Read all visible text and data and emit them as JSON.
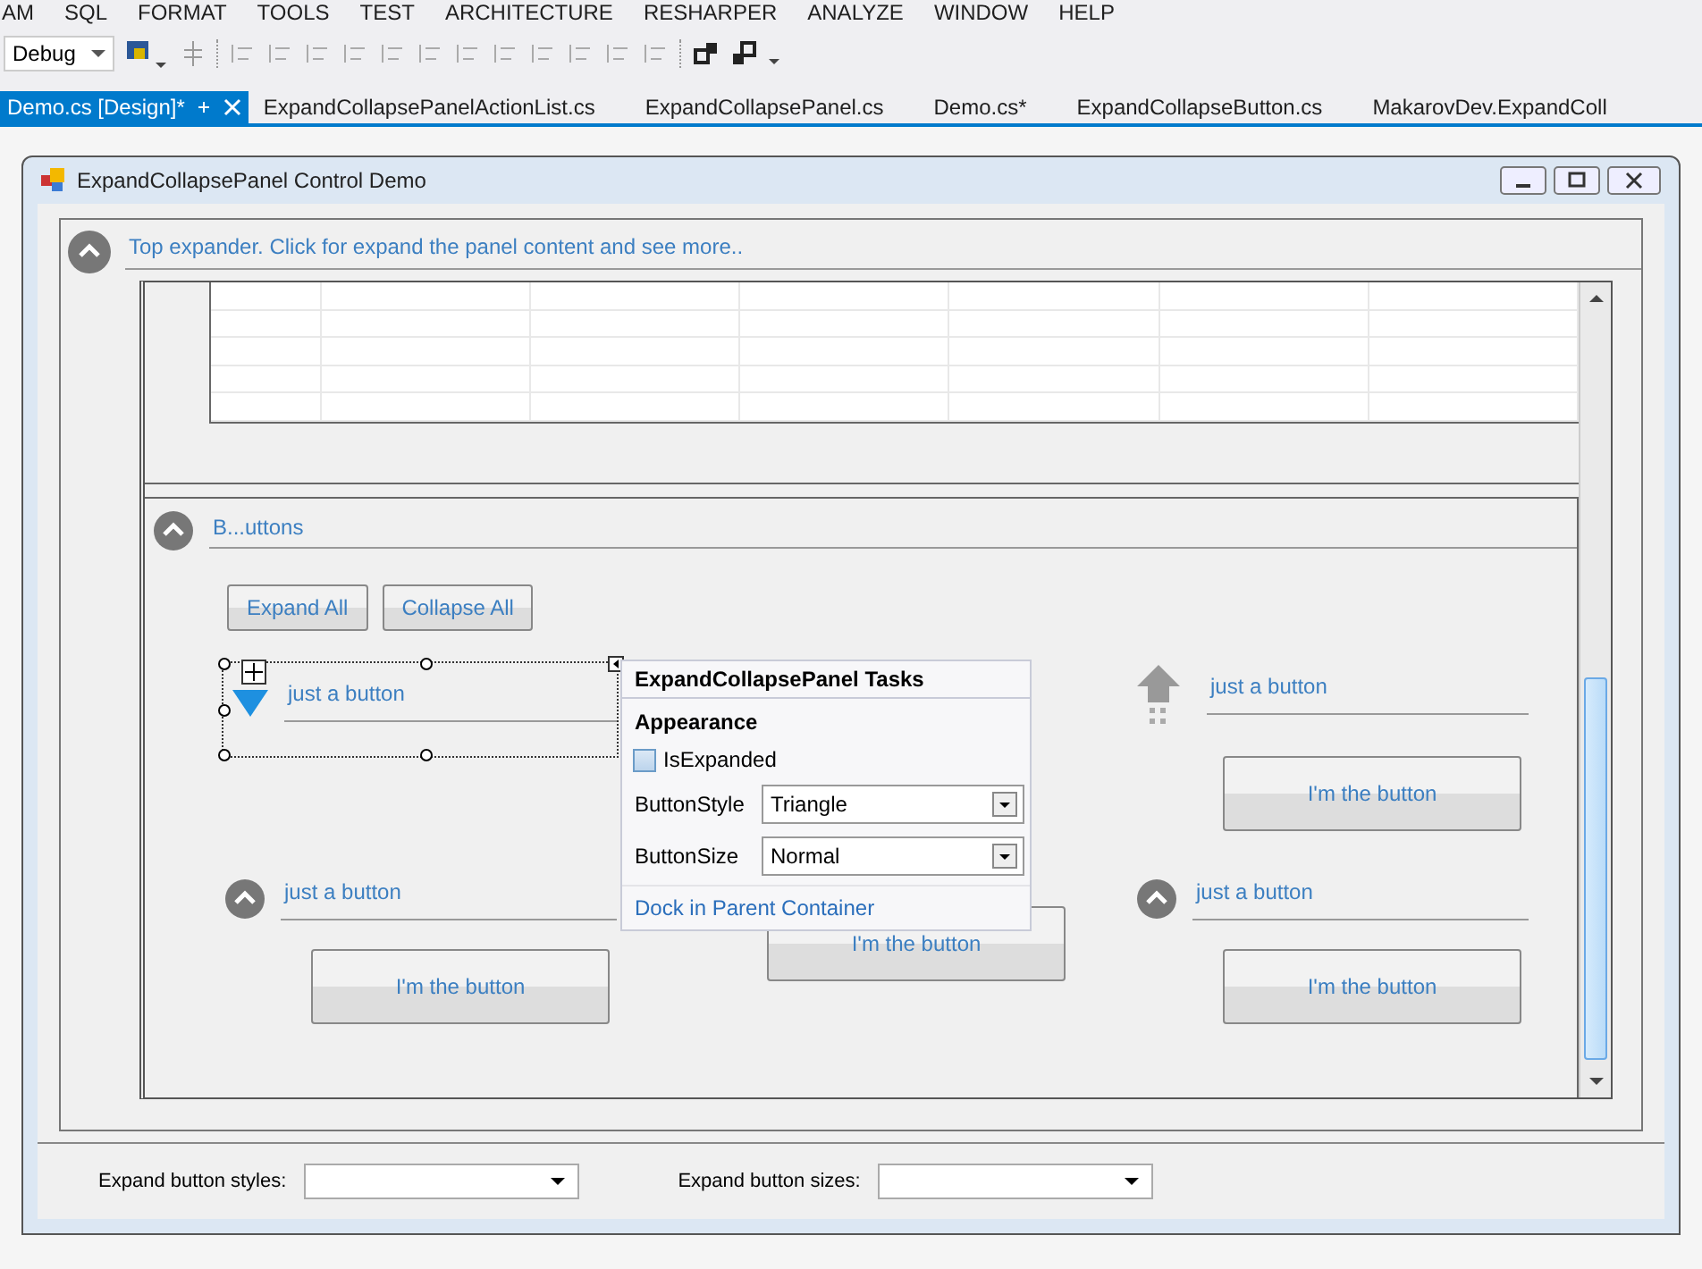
{
  "menu": [
    "AM",
    "SQL",
    "FORMAT",
    "TOOLS",
    "TEST",
    "ARCHITECTURE",
    "RESHARPER",
    "ANALYZE",
    "WINDOW",
    "HELP"
  ],
  "toolbar": {
    "configuration": "Debug"
  },
  "tabs": [
    {
      "label": "Demo.cs [Design]*",
      "selected": true
    },
    {
      "label": "ExpandCollapsePanelActionList.cs",
      "selected": false
    },
    {
      "label": "ExpandCollapsePanel.cs",
      "selected": false
    },
    {
      "label": "Demo.cs*",
      "selected": false
    },
    {
      "label": "ExpandCollapseButton.cs",
      "selected": false
    },
    {
      "label": "MakarovDev.ExpandColl",
      "selected": false
    }
  ],
  "form": {
    "title": "ExpandCollapsePanel Control Demo",
    "top_expander": {
      "header": "Top expander. Click for expand the panel content and see more.."
    },
    "buttons_panel": {
      "header": "B...uttons",
      "actions": [
        "Expand All",
        "Collapse All"
      ],
      "panels": [
        {
          "kind": "triangle",
          "header": "just a button",
          "selected": true
        },
        {
          "kind": "none"
        },
        {
          "kind": "arrow",
          "header": "just a button",
          "button": "I'm the button",
          "selected": false
        },
        {
          "kind": "circle",
          "header": "just a button",
          "button": "I'm the button",
          "selected": false
        },
        {
          "kind": "hidden",
          "button": "I'm the button",
          "selected": false
        },
        {
          "kind": "circle",
          "header": "just a button",
          "button": "I'm the button",
          "selected": false
        }
      ]
    },
    "tasks": {
      "title": "ExpandCollapsePanel Tasks",
      "section": "Appearance",
      "is_expanded": {
        "label": "IsExpanded",
        "checked": false
      },
      "fields": [
        {
          "label": "ButtonStyle",
          "value": "Triangle"
        },
        {
          "label": "ButtonSize",
          "value": "Normal"
        }
      ],
      "link": "Dock in Parent Container"
    },
    "footer": [
      {
        "label": "Expand button styles:"
      },
      {
        "label": "Expand button sizes:"
      }
    ]
  }
}
